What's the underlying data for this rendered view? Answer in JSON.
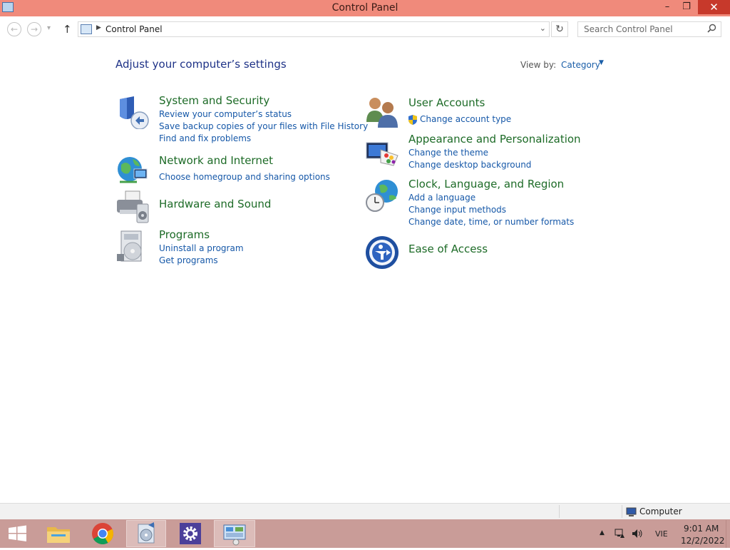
{
  "window": {
    "title": "Control Panel",
    "minimize": "–",
    "maximize": "❐",
    "close": "✕"
  },
  "nav": {
    "back": "←",
    "forward": "→",
    "recent": "▾",
    "up": "↑"
  },
  "address": {
    "crumb": "Control Panel",
    "crumb_arrow": "▶",
    "dropdown": "⌄",
    "refresh": "↻"
  },
  "search": {
    "placeholder": "Search Control Panel",
    "icon": "search-icon"
  },
  "header": {
    "title": "Adjust your computer’s settings",
    "view_by_label": "View by:",
    "view_by_value": "Category"
  },
  "categories_left": [
    {
      "title": "System and Security",
      "icon": "shield-icon",
      "links": [
        "Review your computer’s status",
        "Save backup copies of your files with File History",
        "Find and fix problems"
      ]
    },
    {
      "title": "Network and Internet",
      "icon": "globe-network-icon",
      "links": [
        "Choose homegroup and sharing options"
      ]
    },
    {
      "title": "Hardware and Sound",
      "icon": "printer-icon",
      "links": []
    },
    {
      "title": "Programs",
      "icon": "programs-icon",
      "links": [
        "Uninstall a program",
        "Get programs"
      ]
    }
  ],
  "categories_right": [
    {
      "title": "User Accounts",
      "icon": "users-icon",
      "links": [
        "Change account type"
      ]
    },
    {
      "title": "Appearance and Personalization",
      "icon": "monitor-palette-icon",
      "links": [
        "Change the theme",
        "Change desktop background"
      ]
    },
    {
      "title": "Clock, Language, and Region",
      "icon": "clock-globe-icon",
      "links": [
        "Add a language",
        "Change input methods",
        "Change date, time, or number formats"
      ]
    },
    {
      "title": "Ease of Access",
      "icon": "ease-of-access-icon",
      "links": []
    }
  ],
  "status": {
    "text": "Computer"
  },
  "taskbar": {
    "tray_caret": "▲",
    "language": "VIE",
    "time": "9:01 AM",
    "date": "12/2/2022"
  },
  "colors": {
    "titlebar": "#f08a7b",
    "taskbar": "#c99c98",
    "category_title": "#1d6b27",
    "link": "#1658a8"
  }
}
